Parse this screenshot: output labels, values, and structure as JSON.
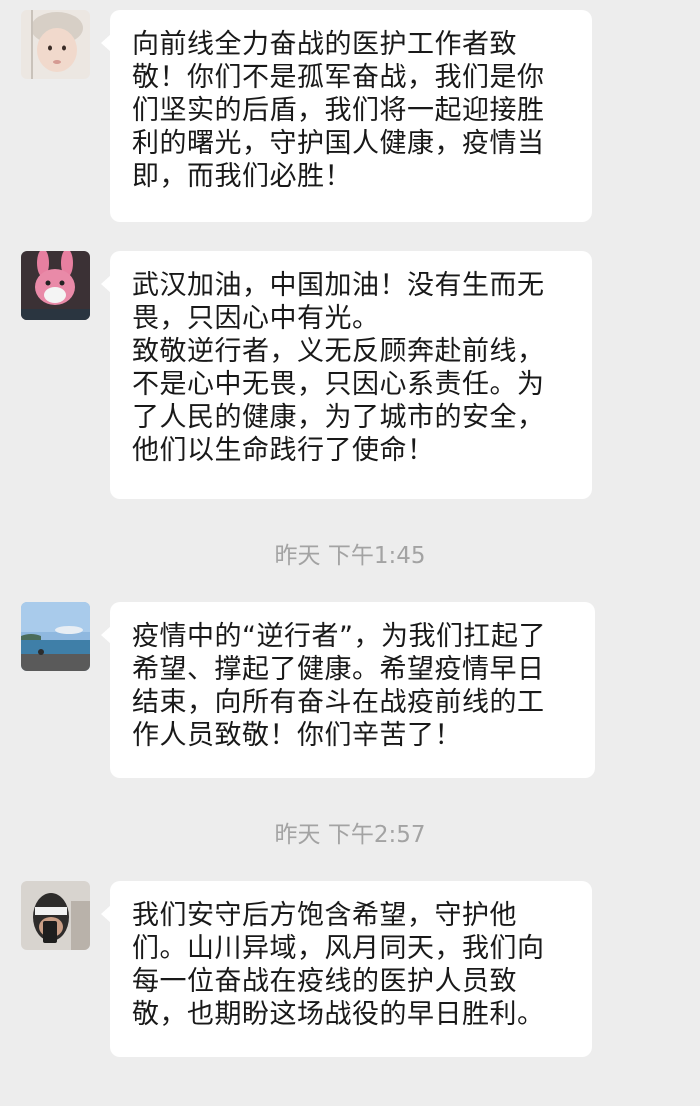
{
  "messages": [
    {
      "avatar": "baby-avatar",
      "lines": "向前线全力奋战的医护工作者致\n敬！你们不是孤军奋战，我们是你\n们坚实的后盾，我们将一起迎接胜\n利的曙光，守护国人健康，疫情当\n即，而我们必胜！"
    },
    {
      "avatar": "pink-rabbit-avatar",
      "lines": "武汉加油，中国加油！没有生而无\n畏，只因心中有光。\n致敬逆行者，义无反顾奔赴前线，\n不是心中无畏，只因心系责任。为\n了人民的健康，为了城市的安全，\n他们以生命践行了使命！"
    },
    {
      "avatar": "seaside-avatar",
      "lines": "疫情中的“逆行者”，为我们扛起了\n希望、撑起了健康。希望疫情早日\n结束，向所有奋斗在战疫前线的工\n作人员致敬！你们辛苦了！"
    },
    {
      "avatar": "person-photo-avatar",
      "lines": "我们安守后方饱含希望，守护他\n们。山川异域，风月同天，我们向\n每一位奋战在疫线的医护人员致\n敬，也期盼这场战役的早日胜利。"
    }
  ],
  "timestamps": [
    "昨天 下午1:45",
    "昨天 下午2:57"
  ]
}
